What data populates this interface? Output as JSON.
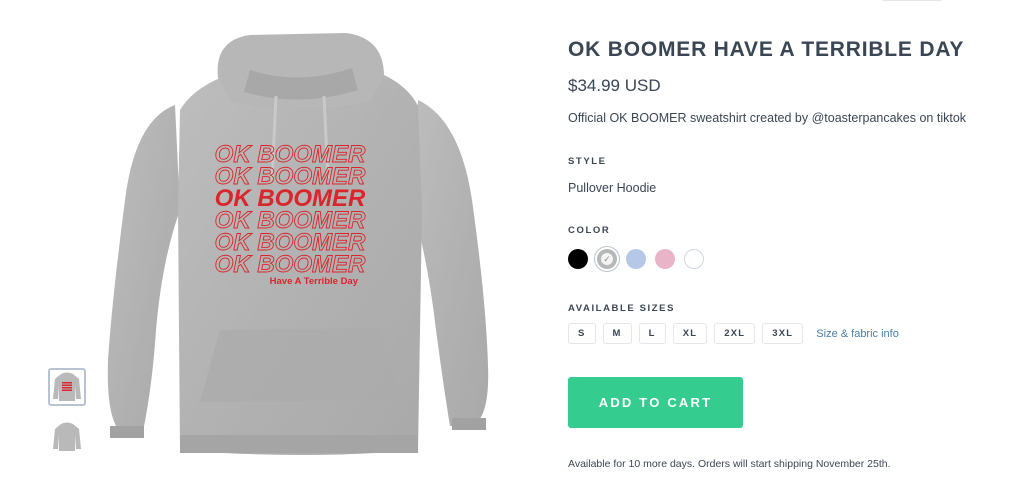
{
  "product": {
    "title": "OK BOOMER HAVE A TERRIBLE DAY",
    "price": "$34.99 USD",
    "description": "Official OK BOOMER sweatshirt created by @toasterpancakes on tiktok"
  },
  "graphic": {
    "main_text": "OK BOOMER",
    "tagline": "Have A Terrible Day"
  },
  "style": {
    "label": "STYLE",
    "value": "Pullover Hoodie"
  },
  "color": {
    "label": "COLOR",
    "swatches": [
      {
        "name": "black",
        "hex": "#000000"
      },
      {
        "name": "heather-grey",
        "hex": "#b7b7b7",
        "selected": true
      },
      {
        "name": "light-blue",
        "hex": "#b5c8e8"
      },
      {
        "name": "pink",
        "hex": "#e9b3c8"
      },
      {
        "name": "white",
        "hex": "#ffffff"
      }
    ]
  },
  "sizes": {
    "label": "AVAILABLE SIZES",
    "options": [
      "S",
      "M",
      "L",
      "XL",
      "2XL",
      "3XL"
    ],
    "guide_link": "Size & fabric info"
  },
  "cart": {
    "button_label": "ADD TO CART",
    "button_color": "#34cc8f"
  },
  "availability": "Available for 10 more days. Orders will start shipping November 25th.",
  "colors": {
    "text": "#3b4654",
    "accent_link": "#4a7fa8",
    "graphic_red": "#d9262c"
  }
}
